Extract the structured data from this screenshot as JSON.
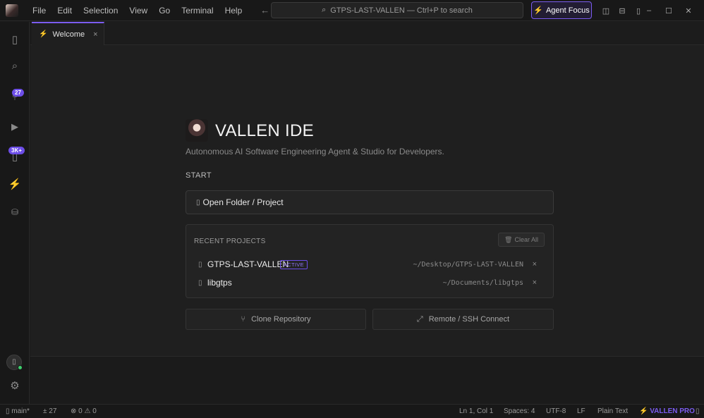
{
  "titlebar": {
    "menu": [
      "File",
      "Edit",
      "Selection",
      "View",
      "Go",
      "Terminal",
      "Help"
    ],
    "back_glyph": "←",
    "forward_glyph": "→",
    "command_search": "GTPS-LAST-VALLEN — Ctrl+P to search",
    "agent_focus_label": "Agent Focus",
    "window_controls": [
      "–",
      "☐",
      "✕"
    ]
  },
  "activity_bar": {
    "source_control_badge": "27",
    "extensions_badge": "3K+"
  },
  "tabs": [
    {
      "label": "Welcome",
      "close": "×"
    }
  ],
  "welcome": {
    "title": "VALLEN IDE",
    "subtitle": "Autonomous AI Software Engineering Agent & Studio for Developers.",
    "start_label": "START",
    "open_folder_label": "Open Folder / Project",
    "recent_title": "RECENT PROJECTS",
    "clear_all_label": "Clear All",
    "recent_projects": [
      {
        "name": "GTPS-LAST-VALLEN",
        "badge": "ACTIVE",
        "path": "~/Desktop/GTPS-LAST-VALLEN",
        "remove": "×"
      },
      {
        "name": "libgtps",
        "badge": "",
        "path": "~/Documents/libgtps",
        "remove": "×"
      }
    ],
    "clone_label": "Clone Repository",
    "remote_label": "Remote / SSH Connect"
  },
  "statusbar": {
    "branch": "main*",
    "changes": "± 27",
    "problems": "⊗ 0 ⚠ 0",
    "cursor": "Ln 1, Col 1",
    "spaces": "Spaces: 4",
    "encoding": "UTF-8",
    "eol": "LF",
    "language": "Plain Text",
    "pro": "⚡ VALLEN PRO"
  },
  "colors": {
    "accent": "#7b5cf0",
    "badge": "#6d4ee8",
    "online": "#3ecf6e"
  }
}
